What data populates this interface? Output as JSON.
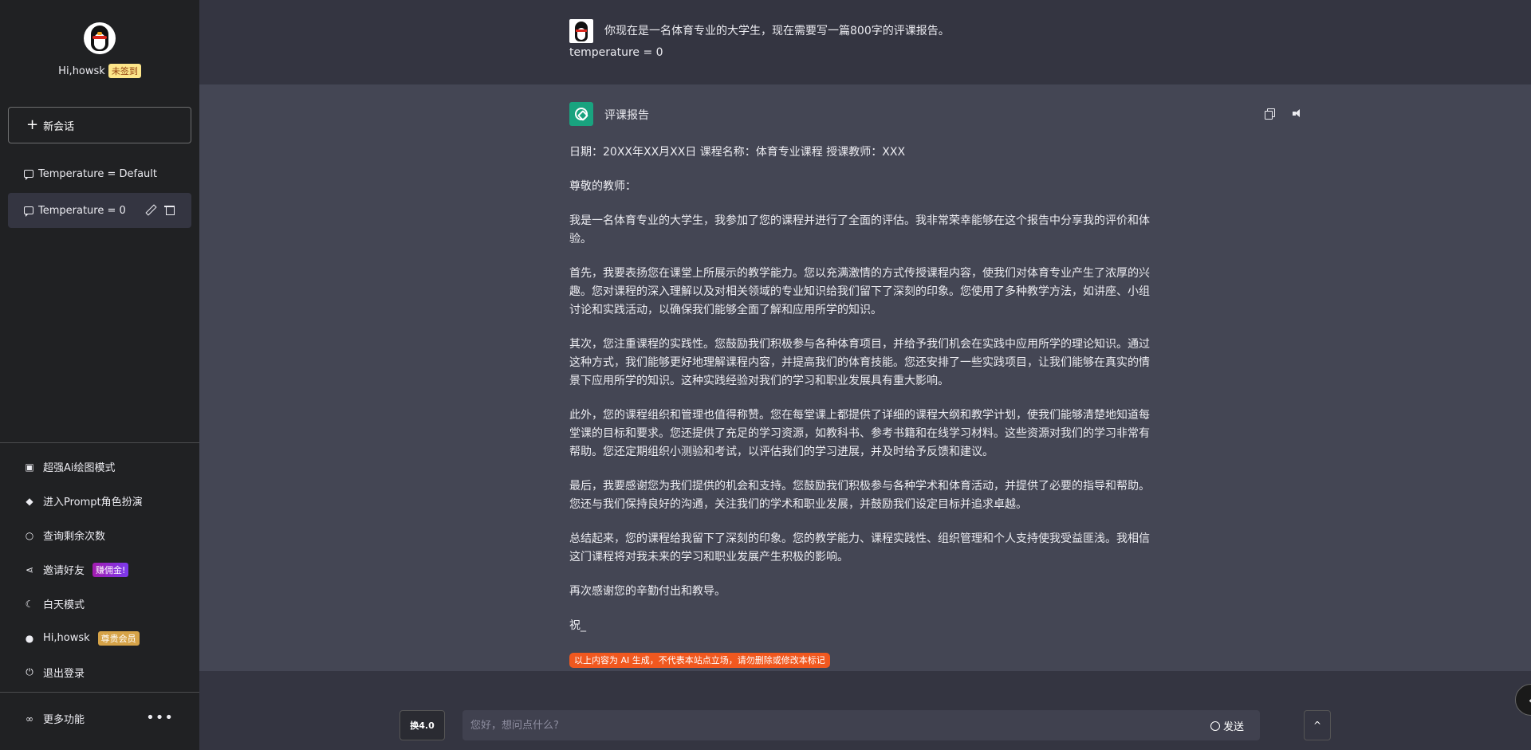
{
  "sidebar": {
    "profile": {
      "greeting": "Hi,howsk",
      "checkin_badge": "未签到"
    },
    "new_chat_label": "新会话",
    "conversations": [
      {
        "label": "Temperature = Default"
      },
      {
        "label": "Temperature = 0"
      }
    ],
    "menu": [
      {
        "label": "超强Ai绘图模式",
        "icon": "image-icon"
      },
      {
        "label": "进入Prompt角色扮演",
        "icon": "graduation-cap-icon"
      },
      {
        "label": "查询剩余次数",
        "icon": "search-icon"
      },
      {
        "label": "邀请好友",
        "icon": "share-icon",
        "badge": "赚佣金!"
      },
      {
        "label": "白天模式",
        "icon": "moon-icon"
      },
      {
        "label": "Hi,howsk",
        "icon": "user-icon",
        "badge": "尊贵会员"
      },
      {
        "label": "退出登录",
        "icon": "power-icon"
      }
    ],
    "more_label": "更多功能"
  },
  "chat": {
    "user_message": {
      "line1": "你现在是一名体育专业的大学生，现在需要写一篇800字的评课报告。",
      "line2": "temperature = 0"
    },
    "ai_message": {
      "title": "评课报告",
      "paragraphs": [
        "日期：20XX年XX月XX日 课程名称：体育专业课程 授课教师：XXX",
        "尊敬的教师：",
        "我是一名体育专业的大学生，我参加了您的课程并进行了全面的评估。我非常荣幸能够在这个报告中分享我的评价和体验。",
        "首先，我要表扬您在课堂上所展示的教学能力。您以充满激情的方式传授课程内容，使我们对体育专业产生了浓厚的兴趣。您对课程的深入理解以及对相关领域的专业知识给我们留下了深刻的印象。您使用了多种教学方法，如讲座、小组讨论和实践活动，以确保我们能够全面了解和应用所学的知识。",
        "其次，您注重课程的实践性。您鼓励我们积极参与各种体育项目，并给予我们机会在实践中应用所学的理论知识。通过这种方式，我们能够更好地理解课程内容，并提高我们的体育技能。您还安排了一些实践项目，让我们能够在真实的情景下应用所学的知识。这种实践经验对我们的学习和职业发展具有重大影响。",
        "此外，您的课程组织和管理也值得称赞。您在每堂课上都提供了详细的课程大纲和教学计划，使我们能够清楚地知道每堂课的目标和要求。您还提供了充足的学习资源，如教科书、参考书籍和在线学习材料。这些资源对我们的学习非常有帮助。您还定期组织小测验和考试，以评估我们的学习进展，并及时给予反馈和建议。",
        "最后，我要感谢您为我们提供的机会和支持。您鼓励我们积极参与各种学术和体育活动，并提供了必要的指导和帮助。您还与我们保持良好的沟通，关注我们的学术和职业发展，并鼓励我们设定目标并追求卓越。",
        "总结起来，您的课程给我留下了深刻的印象。您的教学能力、课程实践性、组织管理和个人支持使我受益匪浅。我相信这门课程将对我未来的学习和职业发展产生积极的影响。",
        "再次感谢您的辛勤付出和教导。",
        "祝_"
      ],
      "notice": "以上内容为 AI 生成，不代表本站点立场，请勿删除或修改本标记"
    }
  },
  "input": {
    "model_button": "换4.0",
    "placeholder": "您好，想问点什么?",
    "send_label": "发送",
    "up_label": "^"
  },
  "colors": {
    "sidebar_bg": "#202123",
    "main_bg": "#343541",
    "ai_bg": "#444654",
    "notice_bg": "#f0581f",
    "gpt_green": "#19a37f"
  }
}
